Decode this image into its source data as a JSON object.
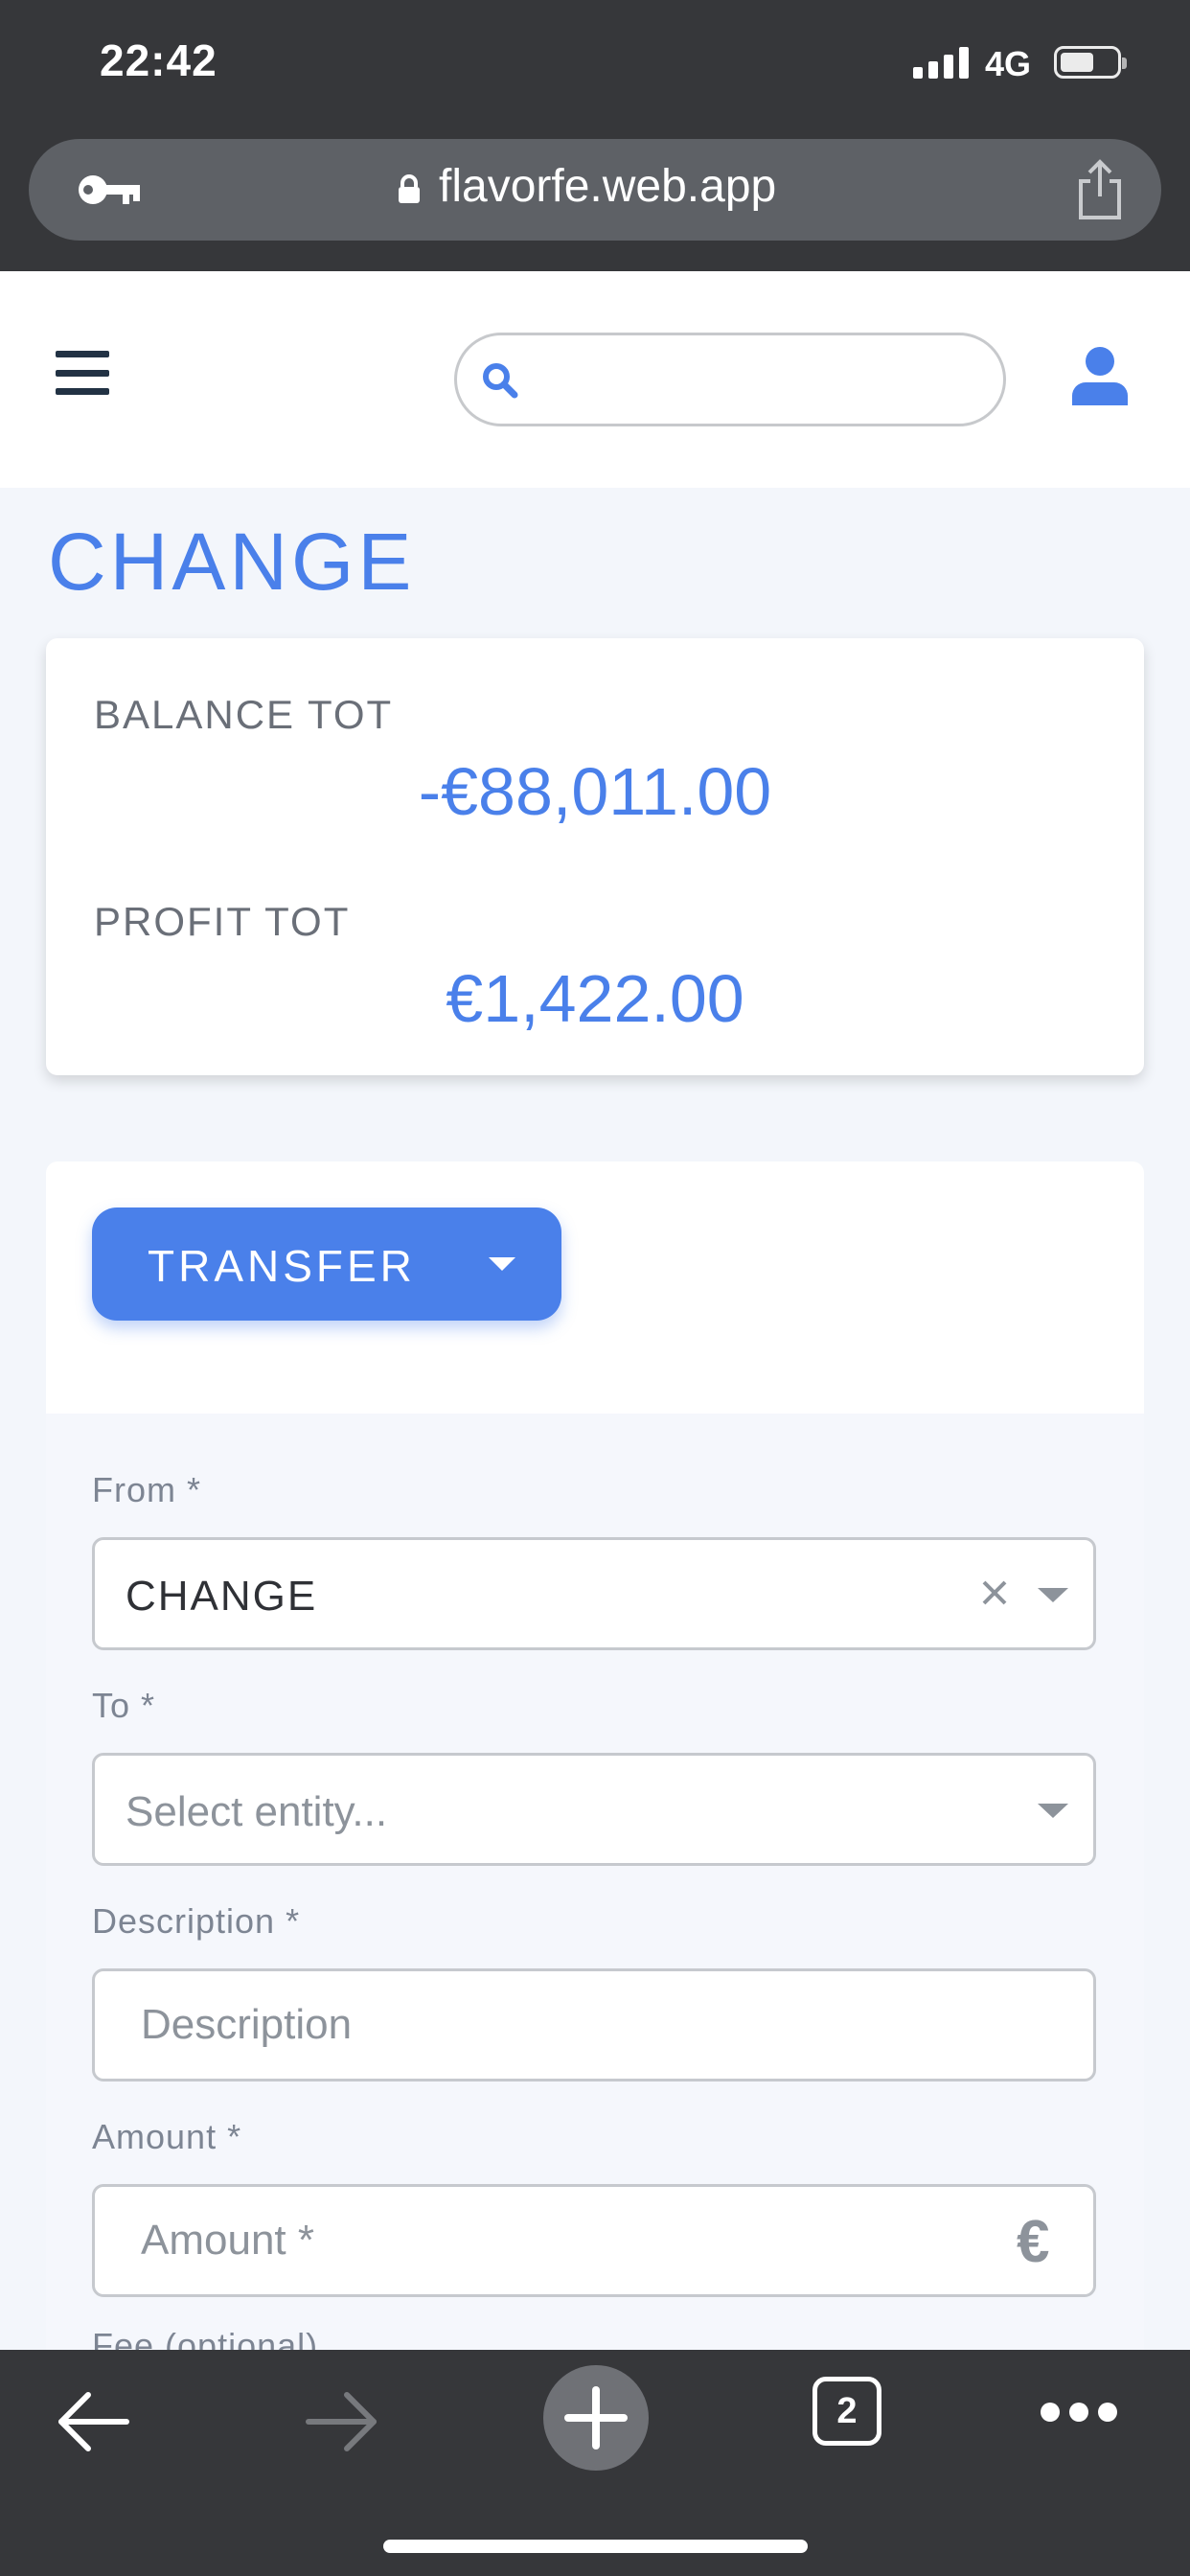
{
  "status_bar": {
    "time": "22:42",
    "network": "4G"
  },
  "browser": {
    "url": "flavorfe.web.app",
    "tabs_count": "2"
  },
  "header": {
    "search": {
      "placeholder": ""
    }
  },
  "page": {
    "title": "CHANGE"
  },
  "summary": {
    "balance_label": "BALANCE TOT",
    "balance_value": "-€88,011.00",
    "profit_label": "PROFIT TOT",
    "profit_value": "€1,422.00"
  },
  "form": {
    "action_button": "TRANSFER",
    "from": {
      "label": "From *",
      "value": "CHANGE"
    },
    "to": {
      "label": "To *",
      "placeholder": "Select entity..."
    },
    "description": {
      "label": "Description *",
      "placeholder": "Description"
    },
    "amount": {
      "label": "Amount *",
      "placeholder": "Amount *",
      "currency_symbol": "€"
    },
    "fee": {
      "label": "Fee (optional)"
    }
  },
  "colors": {
    "accent": "#4a80ea",
    "chrome": "#36373a",
    "background": "#f3f6fb"
  }
}
